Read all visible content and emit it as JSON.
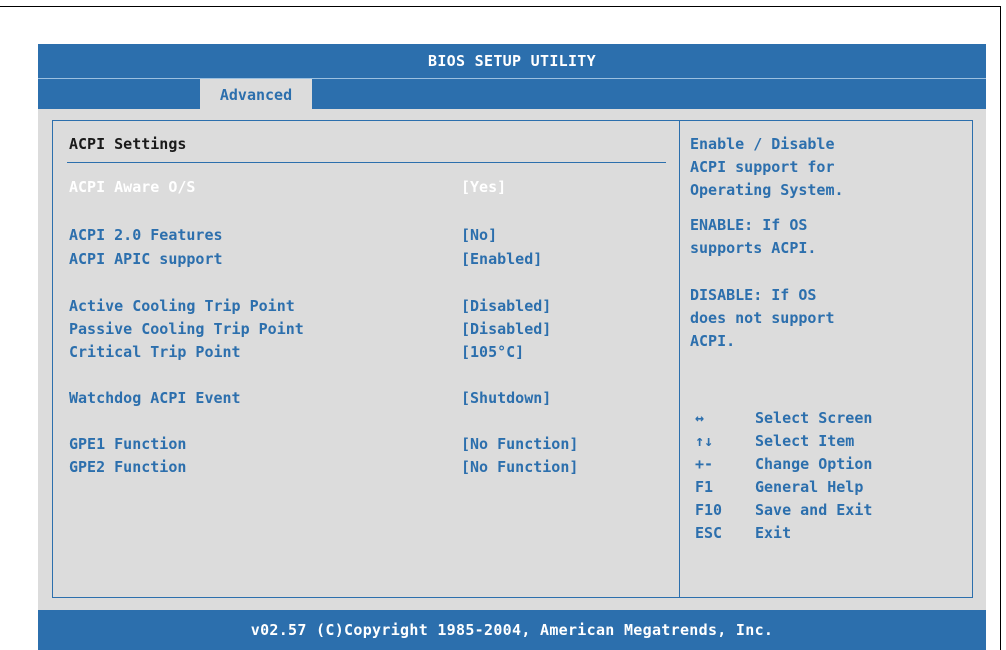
{
  "window": {
    "title": "BIOS SETUP UTILITY"
  },
  "tabs": [
    {
      "label": "Advanced",
      "active": true
    }
  ],
  "main": {
    "section_title": "ACPI Settings",
    "settings": [
      {
        "label": "ACPI Aware O/S",
        "value": "[Yes]",
        "selected": true
      },
      {
        "label": "ACPI 2.0 Features",
        "value": "[No]"
      },
      {
        "label": "ACPI APIC support",
        "value": "[Enabled]"
      },
      {
        "label": "Active Cooling Trip Point",
        "value": "[Disabled]"
      },
      {
        "label": "Passive Cooling Trip Point",
        "value": "[Disabled]"
      },
      {
        "label": "Critical Trip Point",
        "value": "[105°C]"
      },
      {
        "label": "Watchdog ACPI Event",
        "value": "[Shutdown]"
      },
      {
        "label": "GPE1 Function",
        "value": "[No Function]"
      },
      {
        "label": "GPE2 Function",
        "value": "[No Function]"
      }
    ]
  },
  "help": {
    "paragraphs": [
      "Enable / Disable ACPI support for Operating System.",
      "ENABLE: If OS supports ACPI.",
      "DISABLE: If OS does not support ACPI."
    ],
    "lines": [
      "Enable / Disable",
      "ACPI support for",
      "Operating System.",
      "ENABLE: If OS",
      "supports ACPI.",
      "DISABLE: If OS",
      "does not support",
      "ACPI."
    ],
    "keys": [
      {
        "key": "↔",
        "desc": "Select Screen"
      },
      {
        "key": "↑↓",
        "desc": "Select Item"
      },
      {
        "key": "+-",
        "desc": "Change Option"
      },
      {
        "key": "F1",
        "desc": "General Help"
      },
      {
        "key": "F10",
        "desc": "Save and Exit"
      },
      {
        "key": "ESC",
        "desc": "Exit"
      }
    ]
  },
  "footer": {
    "text": "v02.57 (C)Copyright 1985-2004, American Megatrends, Inc."
  },
  "colors": {
    "primary_blue": "#2c6fad",
    "panel_gray": "#dcdcdc",
    "selected_text": "#ffffff",
    "title_text": "#1a1a1a"
  }
}
